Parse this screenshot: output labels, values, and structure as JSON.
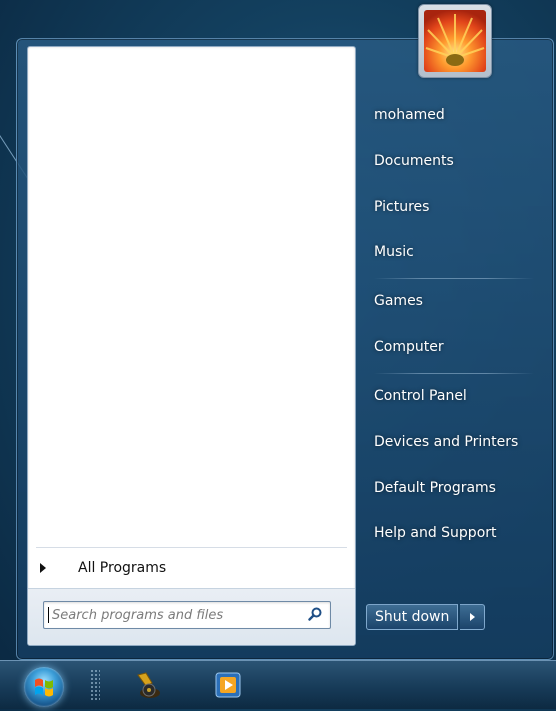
{
  "user": {
    "name": "mohamed"
  },
  "start_menu": {
    "all_programs_label": "All Programs",
    "search_placeholder": "Search programs and files",
    "right_items": [
      "mohamed",
      "Documents",
      "Pictures",
      "Music",
      "Games",
      "Computer",
      "Control Panel",
      "Devices and Printers",
      "Default Programs",
      "Help and Support"
    ],
    "shutdown_label": "Shut down"
  },
  "taskbar": {
    "icons": [
      "start-orb",
      "windows-media-center-icon",
      "windows-media-player-icon"
    ]
  },
  "colors": {
    "desktop_bg": "#13405f",
    "menu_text": "#ffffff",
    "left_pane_bg": "#ffffff",
    "taskbar_bg": "#173b58"
  }
}
